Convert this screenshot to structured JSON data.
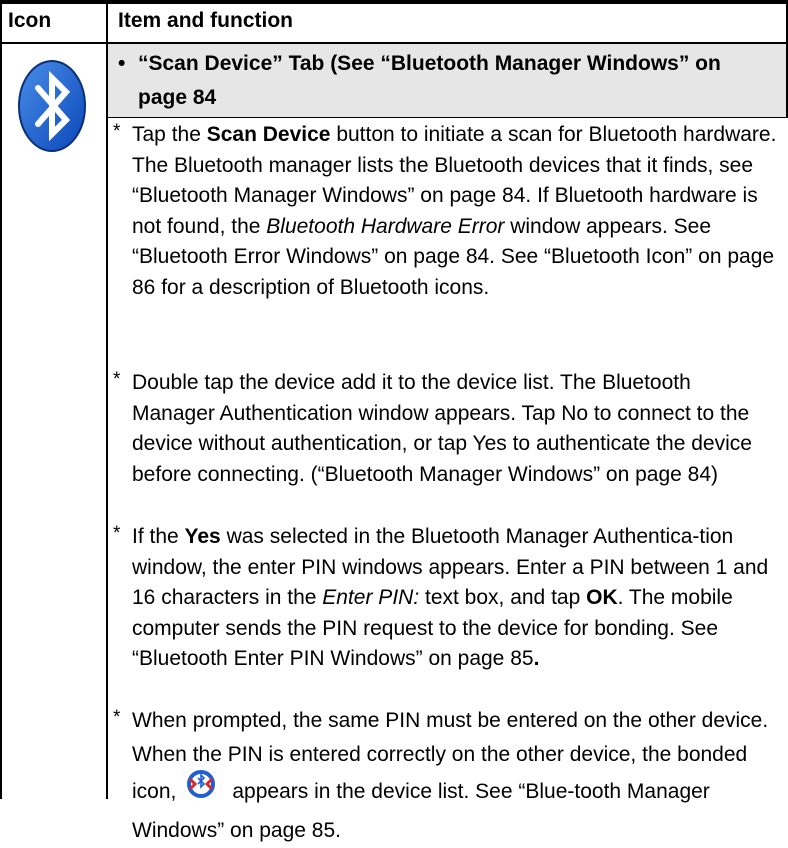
{
  "table": {
    "header_icon": "Icon",
    "header_item": "Item and function"
  },
  "bluetooth_icon": "bluetooth-icon",
  "feature": {
    "bullet": "•",
    "title": "“Scan Device” Tab (See “Bluetooth Manager Windows” on page 84"
  },
  "items": [
    {
      "star": "*",
      "p1": "Tap the ",
      "b1": "Scan Device",
      "p2": " button to initiate a scan for Bluetooth hardware. The Bluetooth manager lists the Bluetooth devices that it finds, see “Bluetooth Manager Windows” on page 84. If Bluetooth hardware is not found, the ",
      "i1": "Bluetooth Hardware Error",
      "p3": "  window appears. See “Bluetooth Error Windows” on page 84. See “Bluetooth Icon” on page 86 for a description of Bluetooth icons."
    },
    {
      "star": "*",
      "p1": "Double tap the device add it to the device list. The Bluetooth Manager Authentication window appears. Tap No to connect to the device without authentication, or tap Yes to authenticate the device before connecting. (“Bluetooth Manager Windows” on page 84)"
    },
    {
      "star": "*",
      "p1": "If the ",
      "b1": "Yes",
      "p2": " was selected in the Bluetooth Manager Authentica-tion window, the enter PIN windows appears. Enter a PIN between 1 and 16 characters in the ",
      "i1": "Enter PIN:",
      "p3": " text box, and tap ",
      "b2": "OK",
      "p4": ". The mobile computer sends the PIN request to  the device for bonding. See “Bluetooth Enter PIN Windows” on page 85",
      "b3": "."
    },
    {
      "star": "*",
      "p1": " When prompted, the same PIN must be entered on the other device. When the PIN is entered correctly on the other device,",
      "p2": "the bonded icon,",
      "icon": "bonded-icon",
      "p3": "appears in the device list. See “Blue-tooth Manager Windows” on page 85."
    }
  ]
}
